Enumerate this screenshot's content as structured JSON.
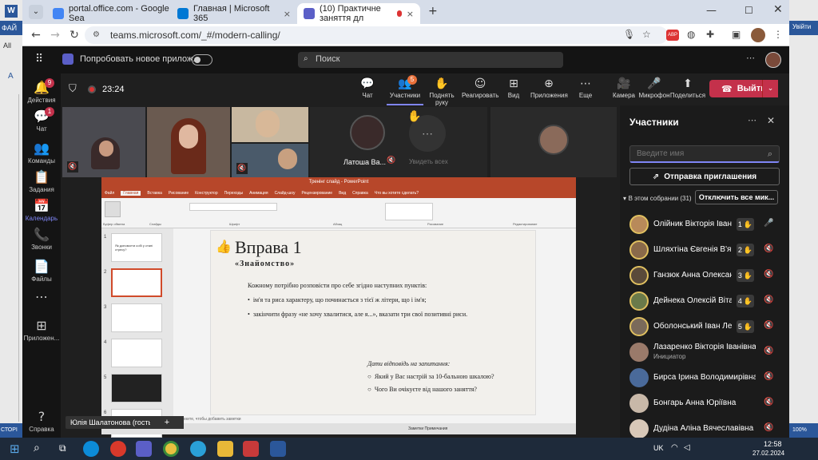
{
  "browser": {
    "tabs": [
      {
        "title": "portal.office.com - Google Sea",
        "color": "#4285f4"
      },
      {
        "title": "Главная | Microsoft 365",
        "color": "#0078d4"
      },
      {
        "title": "(10) Практичне заняття дл",
        "color": "#5b5fc7"
      }
    ],
    "new_tab": "+",
    "url": "teams.microsoft.com/_#/modern-calling/",
    "ext_badge": "ABP"
  },
  "word": {
    "app_letter": "W",
    "ribbon_label": "ФАЙ",
    "side_texts": [
      "All",
      "A"
    ],
    "right_label": "Увійти",
    "status_left": "СТОРІ",
    "status_right": "100%"
  },
  "teams": {
    "promo": "Попробовать новое прилож...",
    "search": "Поиск",
    "rail": [
      {
        "label": "Действия",
        "icon": "🔔",
        "badge": "9"
      },
      {
        "label": "Чат",
        "icon": "💬",
        "badge": "1"
      },
      {
        "label": "Команды",
        "icon": "👥"
      },
      {
        "label": "Задания",
        "icon": "📋"
      },
      {
        "label": "Календарь",
        "icon": "📅"
      },
      {
        "label": "Звонки",
        "icon": "📞"
      },
      {
        "label": "Файлы",
        "icon": "📄"
      },
      {
        "label": "",
        "icon": "⋯"
      },
      {
        "label": "Приложен...",
        "icon": "⊞"
      },
      {
        "label": "Справка",
        "icon": "?"
      }
    ],
    "timer": "23:24",
    "toolbar": [
      {
        "label": "Чат",
        "icon": "💬"
      },
      {
        "label": "Участники",
        "icon": "👥",
        "badge": "5"
      },
      {
        "label": "Поднять руку",
        "icon": "✋"
      },
      {
        "label": "Реагировать",
        "icon": "☺"
      },
      {
        "label": "Вид",
        "icon": "⊞"
      },
      {
        "label": "Приложения",
        "icon": "⊕"
      },
      {
        "label": "Еще",
        "icon": "⋯"
      },
      {
        "label": "Камера",
        "icon": "🎥"
      },
      {
        "label": "Микрофон",
        "icon": "🎤"
      },
      {
        "label": "Поделиться",
        "icon": "⬆"
      }
    ],
    "leave": "Выйти",
    "tile_name": "Латоша Ва...",
    "see_all": "Увидеть всех",
    "presenter": "Юлія Шалатонова (гость)"
  },
  "ppt": {
    "file_title": "Тренінг слайд - PowerPoint",
    "tabs": [
      "Файл",
      "Главная",
      "Вставка",
      "Рисование",
      "Конструктор",
      "Переходы",
      "Анимация",
      "Слайд-шоу",
      "Рецензирование",
      "Вид",
      "Справка",
      "Что вы хотите сделать?"
    ],
    "ribbon_groups": [
      "Буфер обмена",
      "Слайды",
      "Шрифт",
      "Абзац",
      "Рисование",
      "Редактирование"
    ],
    "thumbs": [
      "1",
      "2",
      "3",
      "4",
      "5",
      "6"
    ],
    "thumb_text": "Як допомогти собі у стані стресу?",
    "slide": {
      "title": "Вправа 1",
      "subtitle": "«Знайомство»",
      "intro": "Кожному потрібно розповісти про себе згідно наступних пунктів:",
      "bullets": [
        "ім'я та риса характеру, що починається з тієї ж літери, що і ім'я;",
        "закінчити фразу «не хочу хвалитися, але я...», вказати три свої позитивні риси."
      ],
      "q_header": "Дати відповідь на запитання:",
      "questions": [
        "Який у Вас настрій за 10-бальною шкалою?",
        "Чого Ви очікуєте від нашого заняття?"
      ]
    },
    "notes_hint": "Щелкните, чтобы добавить заметки",
    "status": "Заметки   Примечания"
  },
  "panel": {
    "title": "Участники",
    "search_placeholder": "Введите имя",
    "invite": "Отправка приглашения",
    "section": "В этом собрании (31)",
    "mute_all": "Отключить все мик...",
    "people": [
      {
        "name": "Олійник Вікторія Івані...",
        "hand": "1",
        "mic": "🎤",
        "avatar": "#b88a5a"
      },
      {
        "name": "Шляхтіна Євгенія В'яч...",
        "hand": "2",
        "mic": "🔇",
        "avatar": "#8a6a4a"
      },
      {
        "name": "Ганзюк Анна Олексан...",
        "hand": "3",
        "mic": "🔇",
        "avatar": "#5a4a3a"
      },
      {
        "name": "Дейнека Олексій Віта...",
        "hand": "4",
        "mic": "🔇",
        "avatar": "#6a7a4a"
      },
      {
        "name": "Оболонський Іван Ле...",
        "hand": "5",
        "mic": "🔇",
        "avatar": "#7a6a5a"
      },
      {
        "name": "Лазаренко Вікторія Іванівна",
        "sub": "Инициатор",
        "mic": "🔇",
        "avatar": "#9a7a6a"
      },
      {
        "name": "Бирса Ірина Володимирівна",
        "mic": "🔇",
        "avatar": "#4a6a9a"
      },
      {
        "name": "Бонгарь Анна Юріївна",
        "mic": "🔇",
        "avatar": "#c8b8a8"
      },
      {
        "name": "Дудіна Аліна Вячеславівна",
        "mic": "🔇",
        "avatar": "#d8c8b8"
      }
    ]
  },
  "taskbar": {
    "lang": "UK",
    "time": "12:58",
    "date": "27.02.2024"
  }
}
